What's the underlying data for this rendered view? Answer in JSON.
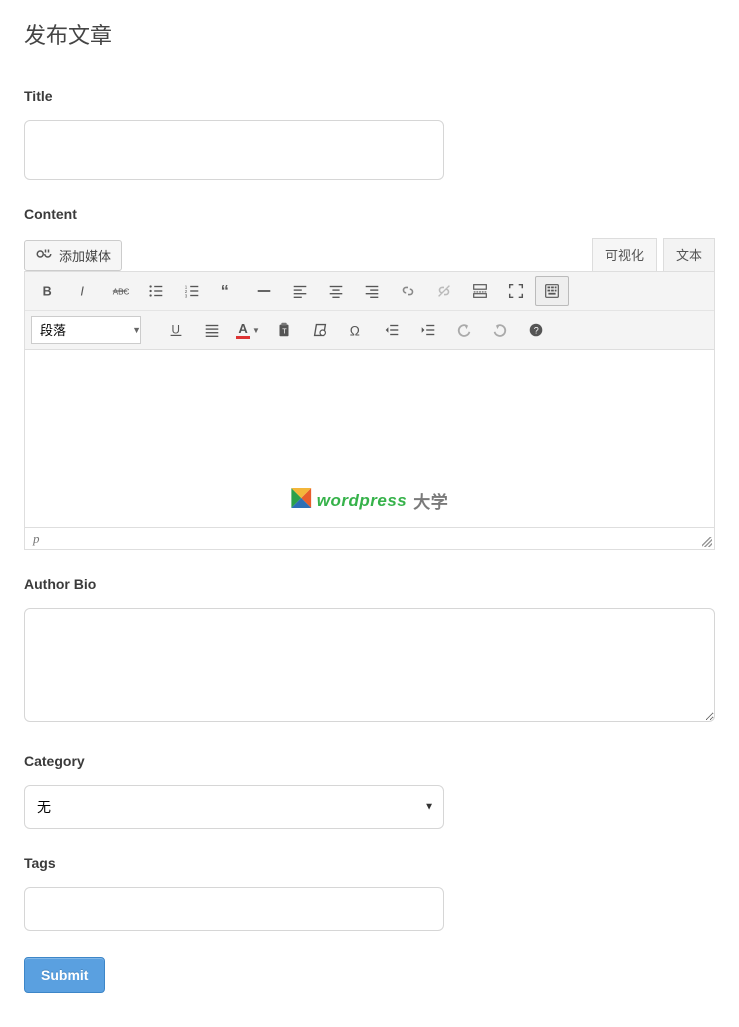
{
  "page": {
    "title": "发布文章"
  },
  "fields": {
    "title_label": "Title",
    "content_label": "Content",
    "author_bio_label": "Author Bio",
    "category_label": "Category",
    "tags_label": "Tags"
  },
  "editor": {
    "add_media_label": "添加媒体",
    "tabs": {
      "visual": "可视化",
      "text": "文本",
      "active": "visual"
    },
    "format_selected": "段落",
    "status_path": "p"
  },
  "category": {
    "selected": "无"
  },
  "watermark": {
    "word": "wordpress",
    "cn": "大学"
  },
  "actions": {
    "submit": "Submit"
  },
  "colors": {
    "accent": "#5aa0e0",
    "brand_green": "#36b24a"
  }
}
